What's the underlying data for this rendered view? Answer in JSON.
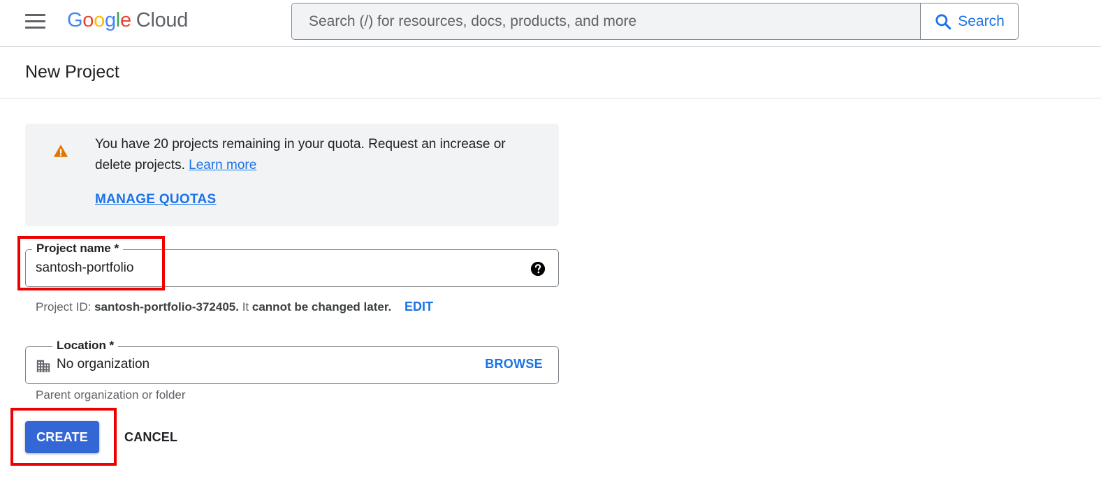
{
  "header": {
    "logo_google": [
      "G",
      "o",
      "o",
      "g",
      "l",
      "e"
    ],
    "logo_cloud": "Cloud",
    "search_placeholder": "Search (/) for resources, docs, products, and more",
    "search_button_label": "Search"
  },
  "page": {
    "title": "New Project"
  },
  "quota_notice": {
    "message": "You have 20 projects remaining in your quota. Request an increase or delete projects.",
    "learn_more_link": "Learn more",
    "manage_quotas_link": "MANAGE QUOTAS"
  },
  "project_name_field": {
    "label": "Project name *",
    "value": "santosh-portfolio"
  },
  "project_id": {
    "prefix": "Project ID:",
    "value": "santosh-portfolio-372405.",
    "it": "It",
    "suffix": "cannot be changed later.",
    "edit_label": "EDIT"
  },
  "location_field": {
    "label": "Location *",
    "value": "No organization",
    "browse_label": "BROWSE",
    "helper": "Parent organization or folder"
  },
  "actions": {
    "create_label": "CREATE",
    "cancel_label": "CANCEL"
  },
  "icons": {
    "menu": "menu-icon",
    "search": "search-icon",
    "warning": "warning-icon",
    "help": "help-icon",
    "organization": "organization-icon"
  },
  "colors": {
    "accent": "#1a73e8",
    "primary_button": "#3367d6",
    "warning": "#e37400",
    "highlight": "#ee0000"
  }
}
